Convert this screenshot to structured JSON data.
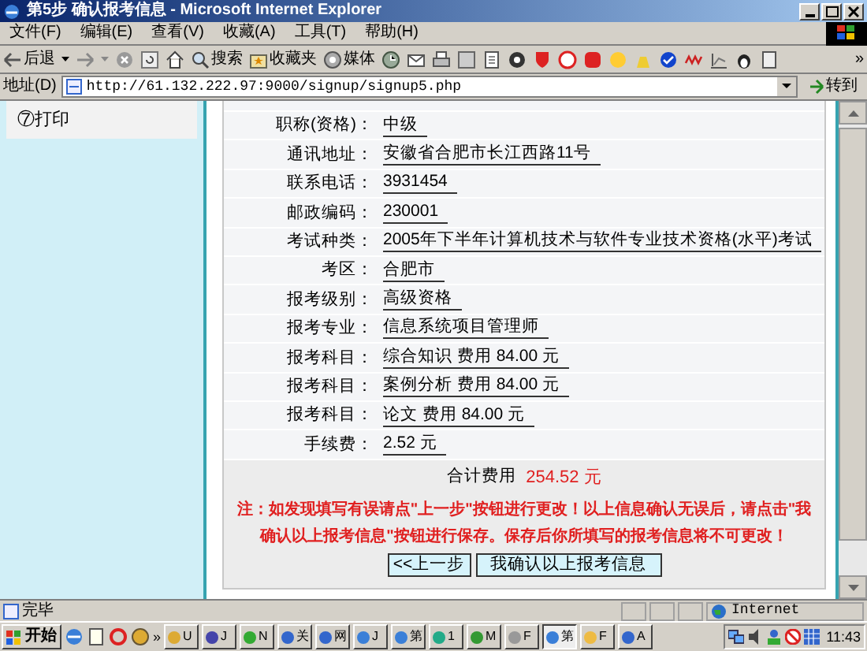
{
  "window": {
    "title": "第5步 确认报考信息 - Microsoft Internet Explorer"
  },
  "menu": [
    "文件(F)",
    "编辑(E)",
    "查看(V)",
    "收藏(A)",
    "工具(T)",
    "帮助(H)"
  ],
  "toolbar": {
    "back": "后退",
    "search": "搜索",
    "favorites": "收藏夹",
    "media": "媒体",
    "more": "»"
  },
  "address": {
    "label": "地址(D)",
    "url": "http://61.132.222.97:9000/signup/signup5.php",
    "go": "转到"
  },
  "sidebar": {
    "items": [
      {
        "label": "⑦打印"
      }
    ]
  },
  "form": {
    "rows": [
      {
        "label": "职称(资格)：",
        "value": "中级"
      },
      {
        "label": "通讯地址：",
        "value": "安徽省合肥市长江西路11号"
      },
      {
        "label": "联系电话：",
        "value": "3931454"
      },
      {
        "label": "邮政编码：",
        "value": "230001"
      },
      {
        "label": "考试种类：",
        "value": "2005年下半年计算机技术与软件专业技术资格(水平)考试"
      },
      {
        "label": "考区：",
        "value": "合肥市"
      },
      {
        "label": "报考级别：",
        "value": "高级资格"
      },
      {
        "label": "报考专业：",
        "value": "信息系统项目管理师"
      },
      {
        "label": "报考科目：",
        "value": "综合知识 费用 84.00 元"
      },
      {
        "label": "报考科目：",
        "value": "案例分析 费用 84.00 元"
      },
      {
        "label": "报考科目：",
        "value": "论文 费用 84.00 元"
      },
      {
        "label": "手续费：",
        "value": "2.52 元"
      }
    ],
    "total": {
      "label": "合计费用",
      "value": "254.52 元"
    },
    "note": "注：如发现填写有误请点\"上一步\"按钮进行更改！以上信息确认无误后，请点击\"我确认以上报考信息\"按钮进行保存。保存后你所填写的报考信息将不可更改！",
    "buttons": [
      "<<上一步",
      "我确认以上报考信息"
    ]
  },
  "status_bar": {
    "text": "完毕",
    "zone": "Internet"
  },
  "taskbar": {
    "start": "开始",
    "more": "»",
    "tasks": [
      {
        "label": "U",
        "selected": false
      },
      {
        "label": "J",
        "selected": false
      },
      {
        "label": "N",
        "selected": false
      },
      {
        "label": "关",
        "selected": false
      },
      {
        "label": "网",
        "selected": false
      },
      {
        "label": "J",
        "selected": false
      },
      {
        "label": "第",
        "selected": false
      },
      {
        "label": "1",
        "selected": false
      },
      {
        "label": "M",
        "selected": false
      },
      {
        "label": "F",
        "selected": false
      },
      {
        "label": "第",
        "selected": true
      },
      {
        "label": "F",
        "selected": false
      },
      {
        "label": "A",
        "selected": false
      }
    ],
    "clock": "11:43"
  }
}
